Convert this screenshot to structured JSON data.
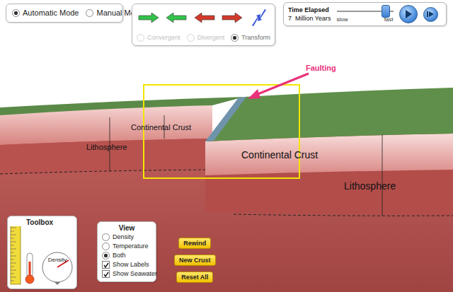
{
  "modes": [
    {
      "label": "Automatic Mode",
      "selected": true
    },
    {
      "label": "Manual Mode",
      "selected": false
    }
  ],
  "boundary_types": [
    {
      "label": "Convergent",
      "selected": false,
      "disabled": true
    },
    {
      "label": "Divergent",
      "selected": false,
      "disabled": true
    },
    {
      "label": "Transform",
      "selected": true,
      "disabled": false
    }
  ],
  "time": {
    "title": "Time Elapsed",
    "value": "7",
    "unit": "Million Years",
    "speed_min": "slow",
    "speed_max": "fast",
    "level": 0.85
  },
  "scene": {
    "annotation": "Faulting",
    "left_crust": "Continental Crust",
    "left_lithosphere": "Lithosphere",
    "right_crust": "Continental Crust",
    "right_lithosphere": "Lithosphere"
  },
  "toolbox": {
    "title": "Toolbox",
    "gauge_label": "Density"
  },
  "view": {
    "title": "View",
    "options": [
      {
        "label": "Density",
        "selected": false
      },
      {
        "label": "Temperature",
        "selected": false
      },
      {
        "label": "Both",
        "selected": true
      }
    ],
    "checks": [
      {
        "label": "Show Labels",
        "checked": true
      },
      {
        "label": "Show Seawater",
        "checked": true
      }
    ]
  },
  "buttons": [
    "Rewind",
    "New Crust",
    "Reset All"
  ]
}
